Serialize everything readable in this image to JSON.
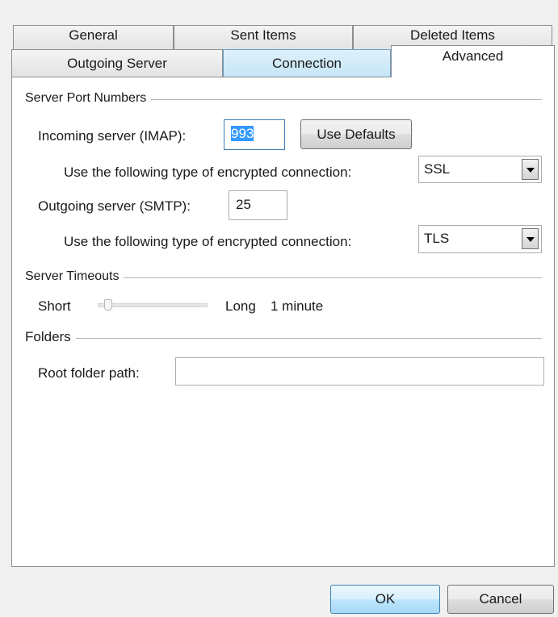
{
  "tabs": {
    "row_back": [
      "General",
      "Sent Items",
      "Deleted Items"
    ],
    "row_front": [
      "Outgoing Server",
      "Connection",
      "Advanced"
    ]
  },
  "server_ports": {
    "group_label": "Server Port Numbers",
    "incoming_label": "Incoming server (IMAP):",
    "incoming_value": "993",
    "use_defaults_label": "Use Defaults",
    "incoming_encryption_label": "Use the following type of encrypted connection:",
    "incoming_encryption_value": "SSL",
    "outgoing_label": "Outgoing server (SMTP):",
    "outgoing_value": "25",
    "outgoing_encryption_label": "Use the following type of encrypted connection:",
    "outgoing_encryption_value": "TLS"
  },
  "server_timeouts": {
    "group_label": "Server Timeouts",
    "short_label": "Short",
    "long_label": "Long",
    "value_label": "1 minute",
    "slider_level": 0.1
  },
  "folders": {
    "group_label": "Folders",
    "root_folder_label": "Root folder path:",
    "root_folder_value": ""
  },
  "footer": {
    "ok_label": "OK",
    "cancel_label": "Cancel"
  }
}
